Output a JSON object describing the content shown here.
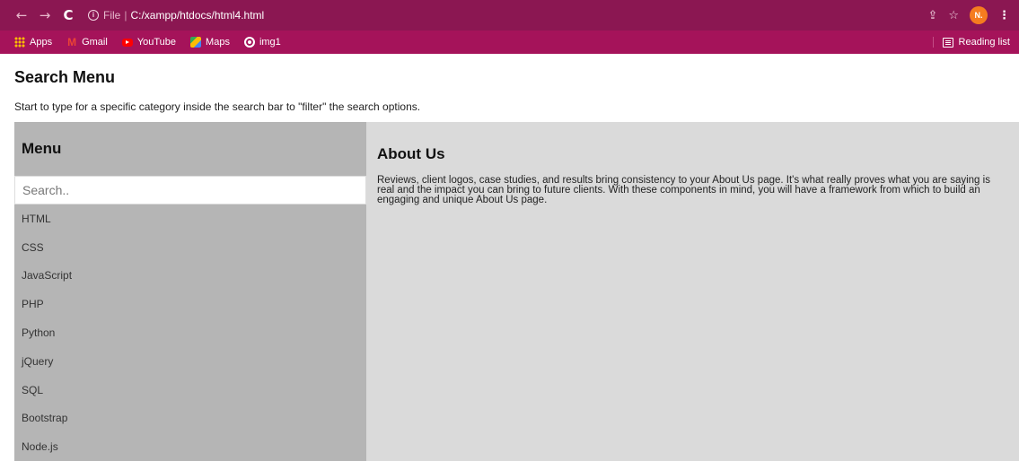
{
  "browser": {
    "nav": {
      "back": "←",
      "forward": "→",
      "reload": "C"
    },
    "address": {
      "scheme_label": "File",
      "separator": "|",
      "url": "C:/xampp/htdocs/html4.html"
    },
    "avatar_initial": "N.",
    "bookmarks": [
      {
        "label": "Apps",
        "icon": "apps-grid-icon"
      },
      {
        "label": "Gmail",
        "icon": "gmail-icon"
      },
      {
        "label": "YouTube",
        "icon": "youtube-icon"
      },
      {
        "label": "Maps",
        "icon": "maps-icon"
      },
      {
        "label": "img1",
        "icon": "globe-icon"
      }
    ],
    "reading_list": "Reading list",
    "colors": {
      "toolbar": "#8b1752",
      "bookmarks_bar": "#a5135a",
      "avatar": "#f57c1f"
    }
  },
  "page": {
    "title": "Search Menu",
    "description": "Start to type for a specific category inside the search bar to \"filter\" the search options."
  },
  "menu": {
    "title": "Menu",
    "search_placeholder": "Search..",
    "items": [
      "HTML",
      "CSS",
      "JavaScript",
      "PHP",
      "Python",
      "jQuery",
      "SQL",
      "Bootstrap",
      "Node.js"
    ],
    "colors": {
      "background": "#b5b5b5"
    }
  },
  "content": {
    "title": "About Us",
    "text": "Reviews, client logos, case studies, and results bring consistency to your About Us page. It's what really proves what you are saying is real and the impact you can bring to future clients. With these components in mind, you will have a framework from which to build an engaging and unique About Us page.",
    "colors": {
      "background": "#dadada"
    }
  }
}
